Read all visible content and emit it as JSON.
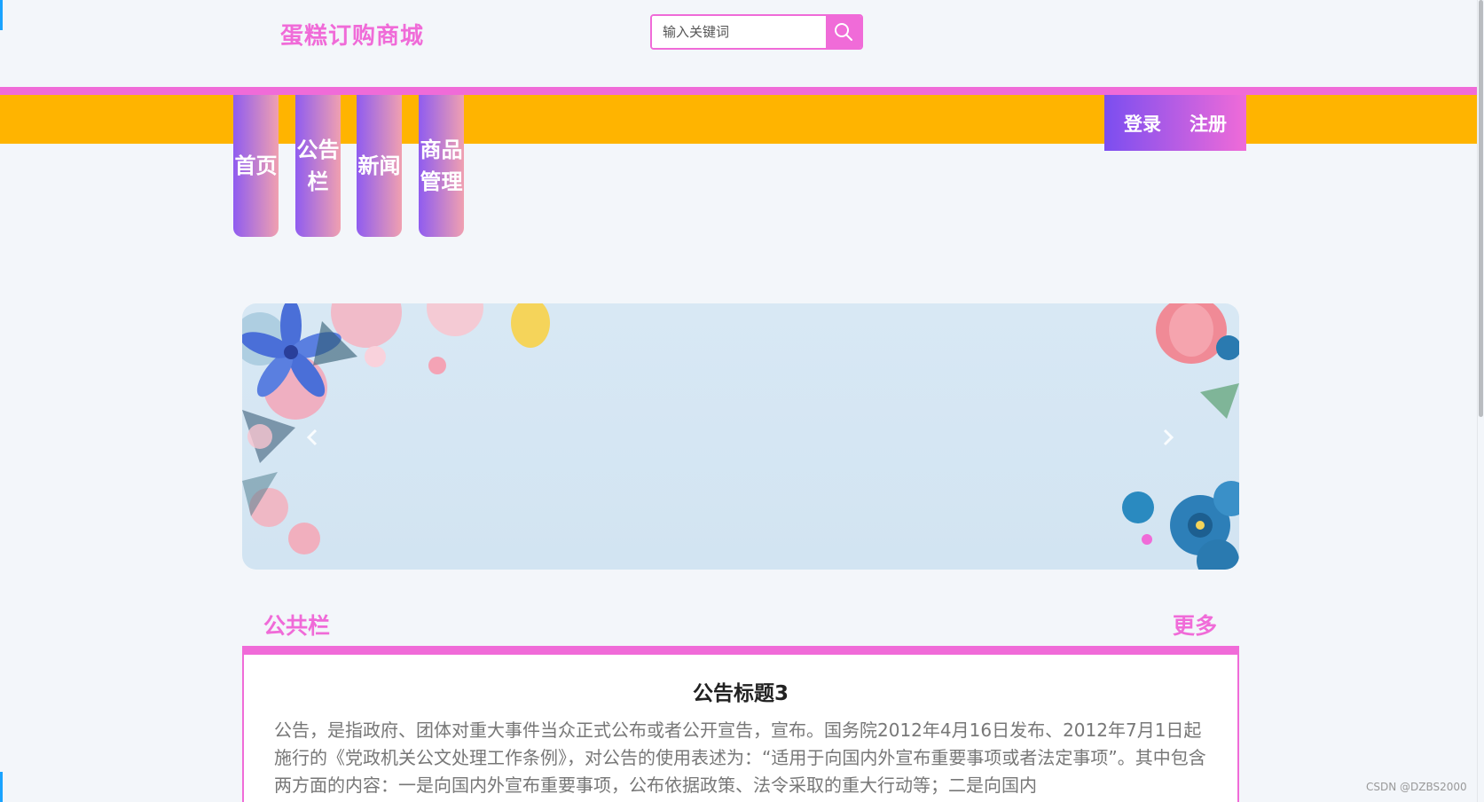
{
  "header": {
    "site_title": "蛋糕订购商城",
    "search_placeholder": "输入关键词"
  },
  "nav": {
    "items": [
      {
        "label": "首页"
      },
      {
        "label": "公告栏"
      },
      {
        "label": "新闻"
      },
      {
        "label": "商品管理"
      }
    ],
    "login": "登录",
    "register": "注册"
  },
  "carousel": {
    "prev_icon": "chevron-left-icon",
    "next_icon": "chevron-right-icon",
    "active_slide": 1
  },
  "notice_section": {
    "title": "公共栏",
    "more": "更多",
    "notice_title": "公告标题3",
    "notice_body": "公告，是指政府、团体对重大事件当众正式公布或者公开宣告，宣布。国务院2012年4月16日发布、2012年7月1日起施行的《党政机关公文处理工作条例》，对公告的使用表述为：“适用于向国内外宣布重要事项或者法定事项”。其中包含两方面的内容：一是向国内外宣布重要事项，公布依据政策、法令采取的重大行动等；二是向国内"
  },
  "watermark": "CSDN @DZBS2000",
  "colors": {
    "accent": "#f06bd8",
    "band": "#ffb400",
    "nav_gradient_start": "#8f5cf0",
    "nav_gradient_end": "#f0a0b0",
    "page_bg": "#f3f6fa"
  }
}
